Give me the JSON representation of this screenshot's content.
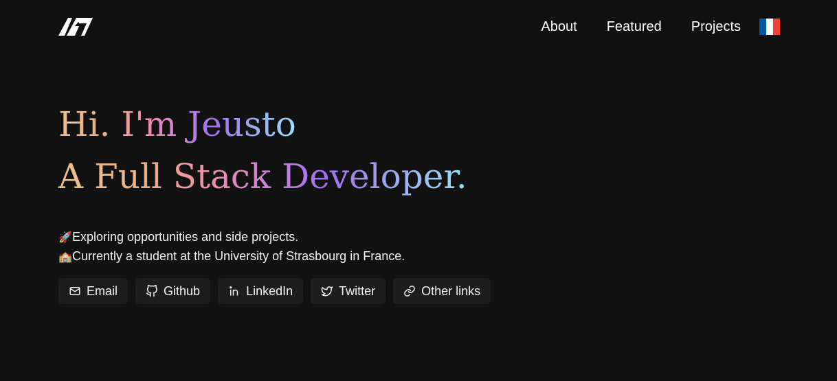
{
  "header": {
    "nav": [
      {
        "label": "About"
      },
      {
        "label": "Featured"
      },
      {
        "label": "Projects"
      }
    ],
    "flag_colors": [
      "#0055A4",
      "#FFFFFF",
      "#EF4135"
    ]
  },
  "hero": {
    "line1": "Hi. I'm Jeusto",
    "line2": "A Full Stack Developer."
  },
  "bio": [
    {
      "icon": "rocket-icon",
      "emoji": "🚀",
      "text": "Exploring opportunities and side projects."
    },
    {
      "icon": "school-icon",
      "emoji": "🏫",
      "text": "Currently a student at the University of Strasbourg in France."
    }
  ],
  "links": [
    {
      "label": "Email",
      "icon": "mail-icon"
    },
    {
      "label": "Github",
      "icon": "github-icon"
    },
    {
      "label": "LinkedIn",
      "icon": "linkedin-icon"
    },
    {
      "label": "Twitter",
      "icon": "twitter-icon"
    },
    {
      "label": "Other links",
      "icon": "link-icon"
    }
  ],
  "colors": {
    "background": "#121212",
    "header_background": "#111111",
    "button_background": "#1d1d1d",
    "gradient": [
      "#f0c090",
      "#f08cb0",
      "#a070ec",
      "#98e0f8"
    ]
  }
}
